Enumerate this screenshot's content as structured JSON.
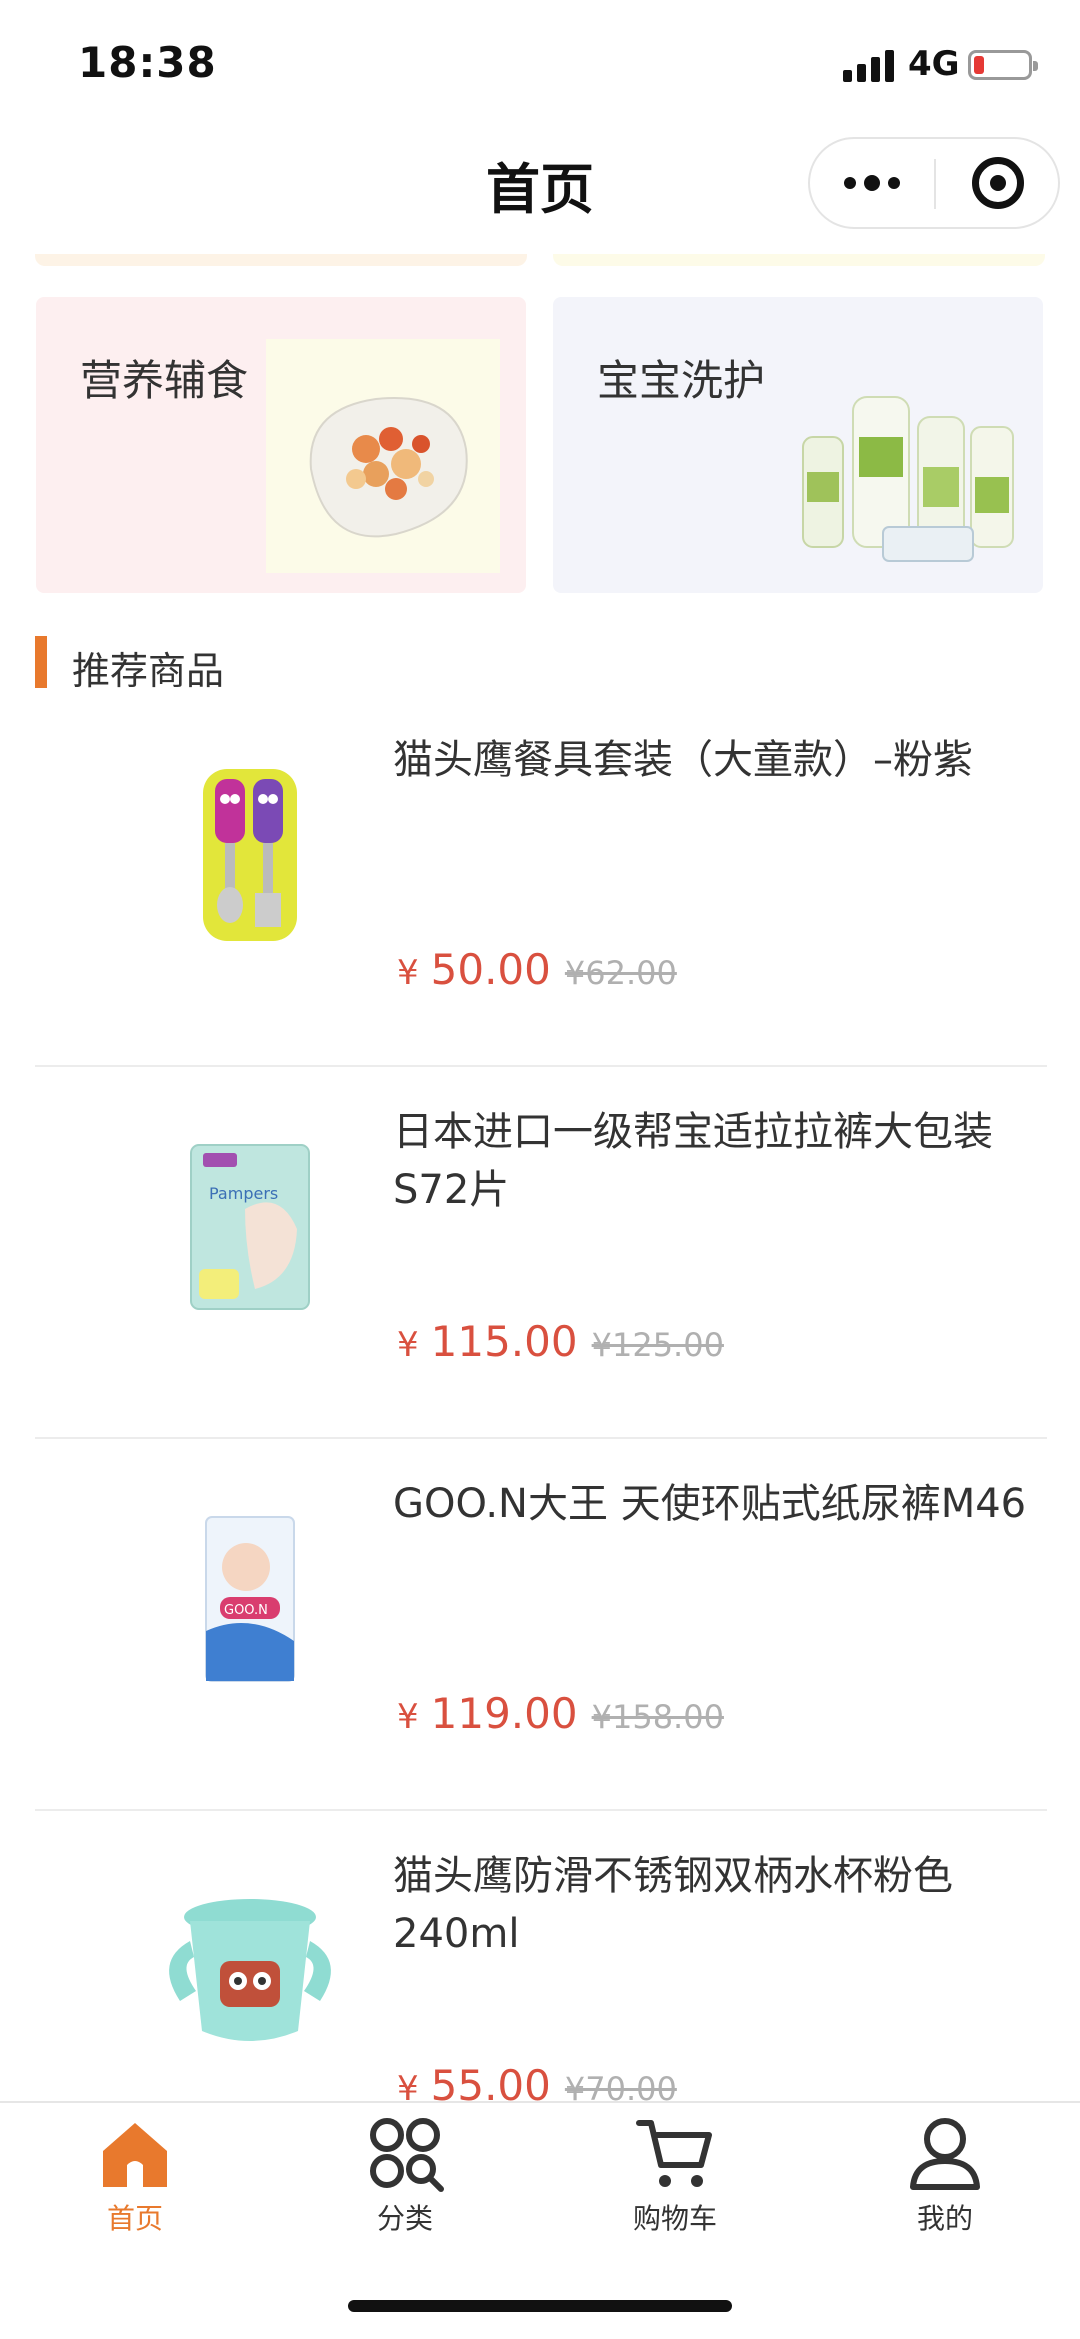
{
  "status": {
    "time": "18:38",
    "network": "4G"
  },
  "nav": {
    "title": "首页"
  },
  "categories": [
    {
      "label": "营养辅食",
      "bg": "#fdeff0"
    },
    {
      "label": "宝宝洗护",
      "bg": "#f3f4fa"
    }
  ],
  "section": {
    "title": "推荐商品"
  },
  "products": [
    {
      "name": "猫头鹰餐具套装（大童款）–粉紫",
      "price": "50.00",
      "currency": "¥",
      "original": "¥62.00"
    },
    {
      "name": "日本进口一级帮宝适拉拉裤大包装S72片",
      "price": "115.00",
      "currency": "¥",
      "original": "¥125.00"
    },
    {
      "name": "GOO.N大王 天使环贴式纸尿裤M46",
      "price": "119.00",
      "currency": "¥",
      "original": "¥158.00"
    },
    {
      "name": "猫头鹰防滑不锈钢双柄水杯粉色240ml",
      "price": "55.00",
      "currency": "¥",
      "original": "¥70.00"
    }
  ],
  "tabs": [
    {
      "label": "首页",
      "icon": "home-icon",
      "active": true
    },
    {
      "label": "分类",
      "icon": "category-icon",
      "active": false
    },
    {
      "label": "购物车",
      "icon": "cart-icon",
      "active": false
    },
    {
      "label": "我的",
      "icon": "profile-icon",
      "active": false
    }
  ],
  "colors": {
    "accent": "#e8792d",
    "price": "#d9503f"
  }
}
